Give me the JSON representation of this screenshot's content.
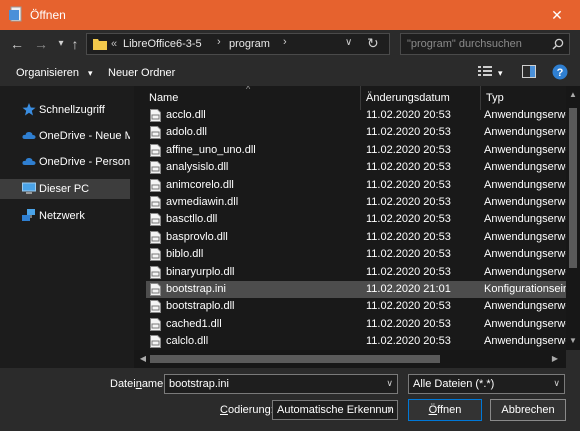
{
  "window": {
    "title": "Öffnen",
    "close_glyph": "✕"
  },
  "nav": {
    "back_glyph": "←",
    "forward_glyph": "→",
    "recent_glyph": "▾",
    "up_glyph": "↑"
  },
  "address": {
    "overflow": "«",
    "crumbs": [
      "LibreOffice6-3-5",
      "program"
    ],
    "separator": "›",
    "dropdown_glyph": "∨",
    "refresh_glyph": "↻"
  },
  "search": {
    "placeholder": "\"program\" durchsuchen"
  },
  "toolbar": {
    "organize": "Organisieren",
    "organize_glyph": "▾",
    "new_folder": "Neuer Ordner",
    "view_glyph": "▾"
  },
  "sidebar": {
    "items": [
      {
        "label": "Schnellzugriff",
        "icon": "star-icon"
      },
      {
        "label": "OneDrive - Neue Me",
        "icon": "cloud-icon"
      },
      {
        "label": "OneDrive - Personal",
        "icon": "cloud-icon"
      },
      {
        "label": "Dieser PC",
        "icon": "pc-icon",
        "selected": true
      },
      {
        "label": "Netzwerk",
        "icon": "network-icon"
      }
    ]
  },
  "columns": {
    "name": "Name",
    "date": "Änderungsdatum",
    "type": "Typ",
    "sort_glyph": "^"
  },
  "files": [
    {
      "name": "acclo.dll",
      "date": "11.02.2020 20:53",
      "type": "Anwendungserwe"
    },
    {
      "name": "adolo.dll",
      "date": "11.02.2020 20:53",
      "type": "Anwendungserwe"
    },
    {
      "name": "affine_uno_uno.dll",
      "date": "11.02.2020 20:53",
      "type": "Anwendungserwe"
    },
    {
      "name": "analysislo.dll",
      "date": "11.02.2020 20:53",
      "type": "Anwendungserwe"
    },
    {
      "name": "animcorelo.dll",
      "date": "11.02.2020 20:53",
      "type": "Anwendungserwe"
    },
    {
      "name": "avmediawin.dll",
      "date": "11.02.2020 20:53",
      "type": "Anwendungserwe"
    },
    {
      "name": "basctllo.dll",
      "date": "11.02.2020 20:53",
      "type": "Anwendungserwe"
    },
    {
      "name": "basprovlo.dll",
      "date": "11.02.2020 20:53",
      "type": "Anwendungserwe"
    },
    {
      "name": "biblo.dll",
      "date": "11.02.2020 20:53",
      "type": "Anwendungserwe"
    },
    {
      "name": "binaryurplo.dll",
      "date": "11.02.2020 20:53",
      "type": "Anwendungserwe"
    },
    {
      "name": "bootstrap.ini",
      "date": "11.02.2020 21:01",
      "type": "Konfigurationsein",
      "selected": true
    },
    {
      "name": "bootstraplo.dll",
      "date": "11.02.2020 20:53",
      "type": "Anwendungserwe"
    },
    {
      "name": "cached1.dll",
      "date": "11.02.2020 20:53",
      "type": "Anwendungserwe"
    },
    {
      "name": "calclo.dll",
      "date": "11.02.2020 20:53",
      "type": "Anwendungserwe"
    }
  ],
  "scroll": {
    "up_glyph": "▲",
    "down_glyph": "▼",
    "left_glyph": "◀",
    "right_glyph": "▶"
  },
  "bottom": {
    "filename_label_pre": "Datei",
    "filename_label_u": "n",
    "filename_label_post": "ame:",
    "filename_value": "bootstrap.ini",
    "filter_value": "Alle Dateien (*.*)",
    "encoding_label_u": "C",
    "encoding_label_post": "odierung:",
    "encoding_value": "Automatische Erkennun",
    "dropdown_glyph": "∨",
    "open_u": "Ö",
    "open_post": "ffnen",
    "cancel_label": "Abbrechen"
  }
}
